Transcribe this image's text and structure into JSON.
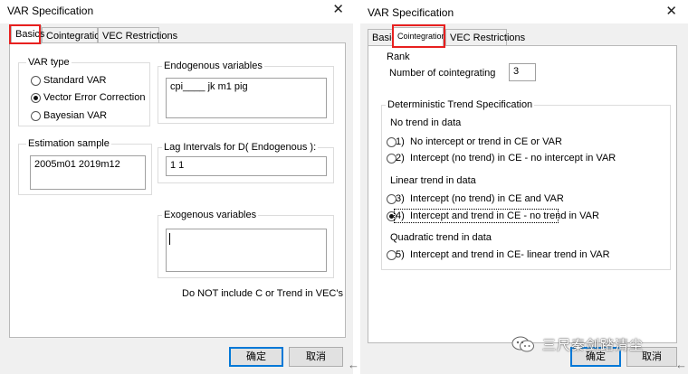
{
  "left": {
    "title": "VAR Specification",
    "tabs": [
      "Basics",
      "Cointegration",
      "VEC Restrictions"
    ],
    "var_type": {
      "title": "VAR type",
      "options": [
        "Standard VAR",
        "Vector Error Correction",
        "Bayesian VAR"
      ],
      "selected": "Vector Error Correction"
    },
    "estimation": {
      "title": "Estimation sample",
      "value": "2005m01 2019m12"
    },
    "endogenous": {
      "title": "Endogenous variables",
      "value": "cpi____ jk m1 pig"
    },
    "lag": {
      "title": "Lag Intervals for D( Endogenous ):",
      "value": "1 1"
    },
    "exogenous": {
      "title": "Exogenous variables",
      "value": ""
    },
    "note": "Do NOT include C or Trend in VEC's",
    "ok_label": "确定",
    "cancel_label": "取消"
  },
  "right": {
    "title": "VAR Specification",
    "tabs": [
      "Basics",
      "Cointegration",
      "VEC Restrictions"
    ],
    "rank": {
      "title": "Rank",
      "label": "Number of cointegrating",
      "value": "3"
    },
    "trend": {
      "title": "Deterministic Trend Specification",
      "groups": [
        {
          "title": "No trend in data",
          "options": [
            {
              "num": "1)",
              "label": "No intercept or trend in CE or VAR"
            },
            {
              "num": "2)",
              "label": "Intercept (no trend) in CE - no intercept in VAR"
            }
          ]
        },
        {
          "title": "Linear trend in data",
          "options": [
            {
              "num": "3)",
              "label": "Intercept (no trend) in CE and VAR"
            },
            {
              "num": "4)",
              "label": "Intercept and trend in CE - no trend in VAR"
            }
          ]
        },
        {
          "title": "Quadratic trend in data",
          "options": [
            {
              "num": "5)",
              "label": "Intercept and trend in CE- linear trend in VAR"
            }
          ]
        }
      ],
      "selected": "4)"
    },
    "ok_label": "确定",
    "cancel_label": "取消"
  },
  "watermark": "三尺秦剑踏清尘",
  "colors": {
    "highlight": "#e8201f",
    "default_button_border": "#0078d7"
  },
  "icons": {
    "close": "close-icon",
    "watermark": "wechat-icon",
    "arrow": "left-arrow-icon"
  }
}
